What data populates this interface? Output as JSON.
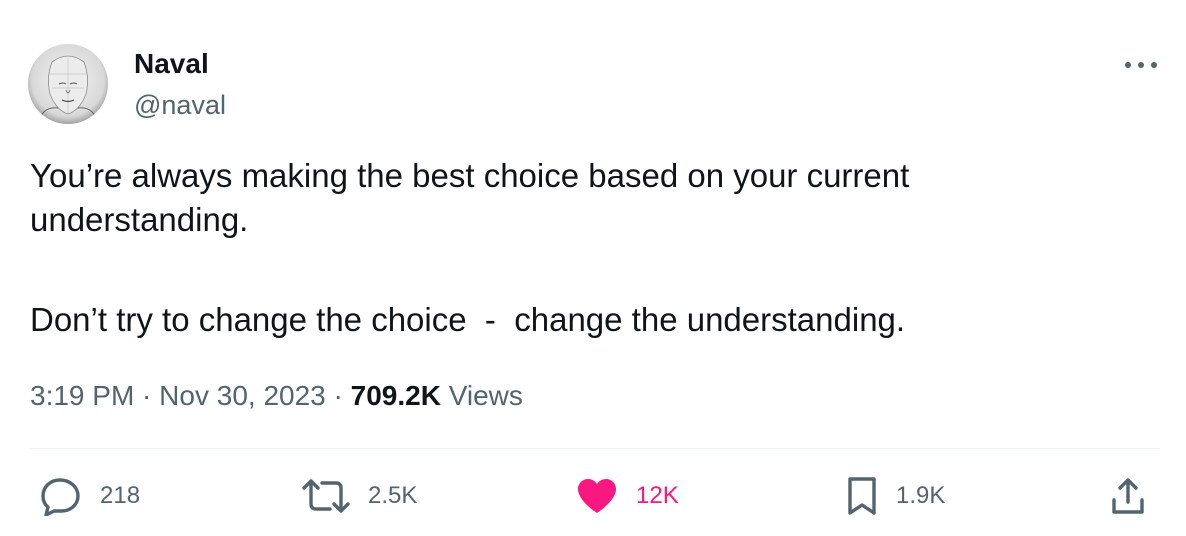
{
  "author": {
    "name": "Naval",
    "handle": "@naval"
  },
  "tweet": {
    "paragraph_1": "You’re always making the best choice based on your current\nunderstanding.",
    "paragraph_2": "Don’t try to change the choice  -  change the understanding."
  },
  "meta": {
    "time": "3:19 PM",
    "separator": " · ",
    "date": "Nov 30, 2023",
    "views_count": "709.2K",
    "views_label": " Views"
  },
  "actions": {
    "replies": "218",
    "reposts": "2.5K",
    "likes": "12K",
    "bookmarks": "1.9K"
  },
  "colors": {
    "text_primary": "#0f1419",
    "text_secondary": "#536471",
    "like": "#f91880",
    "divider": "#eff3f4"
  },
  "icons": [
    "more-icon",
    "reply-icon",
    "repost-icon",
    "like-icon",
    "bookmark-icon",
    "share-icon"
  ]
}
